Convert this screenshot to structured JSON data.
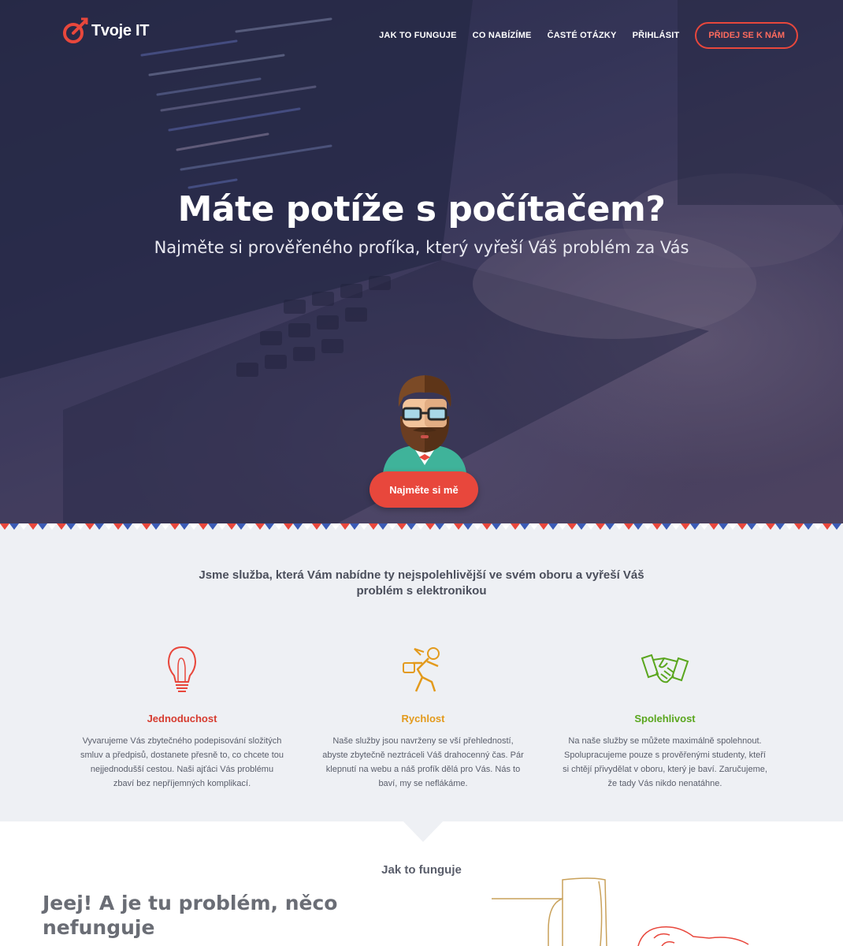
{
  "brand": {
    "name": "Tvoje IT",
    "accent": "#e8473c"
  },
  "nav": {
    "links": [
      "JAK TO FUNGUJE",
      "CO NABÍZÍME",
      "ČASTÉ OTÁZKY",
      "PŘIHLÁSIT"
    ],
    "cta": "PŘIDEJ SE K NÁM"
  },
  "hero": {
    "title": "Máte potíže s počítačem?",
    "subtitle": "Najměte si prověřeného profíka, který vyřeší Váš problém za Vás",
    "button": "Najměte si mě"
  },
  "features": {
    "intro": "Jsme služba, která Vám nabídne ty nejspolehlivější ve svém oboru a vyřeší Váš problém s elektronikou",
    "items": [
      {
        "icon": "lightbulb-icon",
        "color": "#d63b2f",
        "title": "Jednoduchost",
        "text": "Vyvarujeme Vás zbytečného podepisování složitých smluv a předpisů, dostanete přesně to, co chcete tou nejjednodušší cestou. Naši ajťáci Vás problému zbaví bez nepříjemných komplikací."
      },
      {
        "icon": "running-man-icon",
        "color": "#e39a1c",
        "title": "Rychlost",
        "text": "Naše služby jsou navrženy se vší přehledností, abyste zbytečně neztráceli Váš drahocenný čas. Pár klepnutí na webu a náš profík dělá pro Vás. Nás to baví, my se neflákáme."
      },
      {
        "icon": "handshake-icon",
        "color": "#5aa61e",
        "title": "Spolehlivost",
        "text": "Na naše služby se můžete maximálně spolehnout. Spolupracujeme pouze s prověřenými studenty, kteří si chtějí přivydělat v oboru, který je baví. Zaručujeme, že tady Vás nikdo nenatáhne."
      }
    ]
  },
  "how": {
    "label": "Jak to funguje",
    "heading": "Jeej! A je tu problém, něco nefunguje"
  }
}
